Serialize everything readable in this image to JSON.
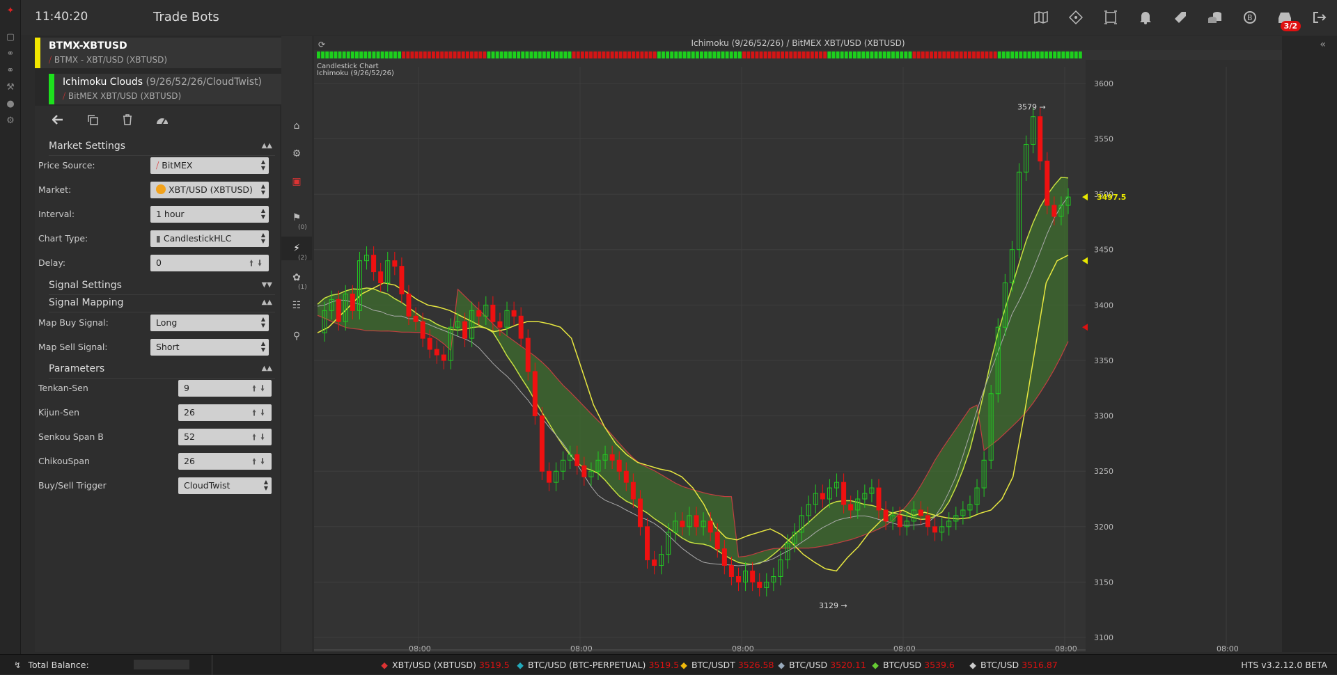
{
  "app": {
    "clock": "11:40:20",
    "title": "Trade Bots"
  },
  "left_rail_icons": [
    "logo-icon",
    "monitor-icon",
    "bot-icon",
    "bot2-icon",
    "tools-icon",
    "user-icon",
    "cogs-icon"
  ],
  "top_icons": [
    "map-icon",
    "ticket-icon",
    "frame-icon",
    "bell-icon",
    "tag-icon",
    "coins-icon",
    "bitcoin-icon",
    "inbox-icon",
    "logout-icon"
  ],
  "inbox_badge": "3/2",
  "crumbs": [
    {
      "title": "BTMX-XBTUSD",
      "subtitle": "BTMX - XBT/USD (XBTUSD)",
      "color": "#f2e600"
    },
    {
      "title": "Ichimoku Clouds",
      "params": "(9/26/52/26/CloudTwist)",
      "subtitle": "BitMEX XBT/USD (XBTUSD)",
      "color": "#1de01d"
    }
  ],
  "sections": {
    "market": "Market Settings",
    "signal": "Signal Settings",
    "mapping": "Signal Mapping",
    "params": "Parameters"
  },
  "market": {
    "price_source": {
      "label": "Price Source:",
      "value": "BitMEX"
    },
    "market": {
      "label": "Market:",
      "value": "XBT/USD (XBTUSD)"
    },
    "interval": {
      "label": "Interval:",
      "value": "1 hour"
    },
    "chart_type": {
      "label": "Chart Type:",
      "value": "CandlestickHLC"
    },
    "delay": {
      "label": "Delay:",
      "value": "0"
    }
  },
  "mapping": {
    "buy": {
      "label": "Map Buy Signal:",
      "value": "Long"
    },
    "sell": {
      "label": "Map Sell Signal:",
      "value": "Short"
    }
  },
  "params": {
    "tenkan": {
      "label": "Tenkan-Sen",
      "value": "9"
    },
    "kijun": {
      "label": "Kijun-Sen",
      "value": "26"
    },
    "senkou": {
      "label": "Senkou Span B",
      "value": "52"
    },
    "chikou": {
      "label": "ChikouSpan",
      "value": "26"
    },
    "trigger": {
      "label": "Buy/Sell Trigger",
      "value": "CloudTwist"
    }
  },
  "vtabs": [
    {
      "icon": "home-icon",
      "count": ""
    },
    {
      "icon": "cogs-icon",
      "count": ""
    },
    {
      "icon": "money-icon",
      "count": ""
    },
    {
      "icon": "flags-icon",
      "count": "(0)"
    },
    {
      "icon": "bolt-icon",
      "count": "(2)"
    },
    {
      "icon": "leaf-icon",
      "count": "(1)"
    },
    {
      "icon": "sitemap-icon",
      "count": ""
    },
    {
      "icon": "unlock-icon",
      "count": ""
    }
  ],
  "chart": {
    "title": "Ichimoku (9/26/52/26) / BitMEX XBT/USD (XBTUSD)",
    "sublabel1": "Candlestick Chart",
    "sublabel2": "Ichimoku (9/26/52/26)",
    "high_label": "3579",
    "low_label": "3129",
    "last_label": "3497.5"
  },
  "chart_data": {
    "type": "candlestick",
    "y_ticks": [
      "3600",
      "3550",
      "3500",
      "3450",
      "3400",
      "3350",
      "3300",
      "3250",
      "3200",
      "3150",
      "3100"
    ],
    "x_ticks": [
      "08:00",
      "08:00",
      "08:00",
      "08:00",
      "08:00",
      "08:00"
    ],
    "ylim": [
      3090,
      3615
    ],
    "last_price": 3497.5,
    "high": 3579,
    "low": 3129,
    "close_path": [
      3375,
      3395,
      3405,
      3385,
      3410,
      3395,
      3440,
      3445,
      3430,
      3420,
      3440,
      3435,
      3410,
      3390,
      3385,
      3370,
      3360,
      3355,
      3350,
      3380,
      3385,
      3370,
      3395,
      3390,
      3400,
      3385,
      3380,
      3395,
      3390,
      3370,
      3340,
      3300,
      3250,
      3240,
      3250,
      3260,
      3265,
      3255,
      3245,
      3250,
      3260,
      3265,
      3260,
      3250,
      3240,
      3225,
      3200,
      3170,
      3165,
      3175,
      3195,
      3205,
      3200,
      3210,
      3200,
      3205,
      3195,
      3180,
      3165,
      3155,
      3150,
      3160,
      3150,
      3145,
      3150,
      3155,
      3170,
      3185,
      3195,
      3210,
      3220,
      3230,
      3225,
      3235,
      3240,
      3220,
      3215,
      3225,
      3230,
      3235,
      3215,
      3205,
      3210,
      3200,
      3205,
      3215,
      3210,
      3200,
      3195,
      3200,
      3205,
      3210,
      3215,
      3220,
      3235,
      3260,
      3320,
      3380,
      3420,
      3450,
      3520,
      3545,
      3570,
      3530,
      3490,
      3480,
      3490,
      3497.5
    ],
    "tenkan_path": [
      3375,
      3380,
      3390,
      3400,
      3410,
      3415,
      3420,
      3418,
      3412,
      3405,
      3400,
      3398,
      3395,
      3390,
      3385,
      3380,
      3376,
      3378,
      3382,
      3385,
      3385,
      3383,
      3380,
      3370,
      3340,
      3310,
      3290,
      3275,
      3265,
      3258,
      3255,
      3252,
      3250,
      3245,
      3235,
      3220,
      3200,
      3190,
      3188,
      3192,
      3195,
      3198,
      3193,
      3185,
      3175,
      3168,
      3162,
      3160,
      3172,
      3182,
      3195,
      3205,
      3212,
      3215,
      3210,
      3213,
      3210,
      3208,
      3207,
      3208,
      3212,
      3215,
      3225,
      3245,
      3300,
      3360,
      3420,
      3440,
      3445
    ],
    "signal_strip": [
      "green",
      "red",
      "green",
      "red",
      "green",
      "red",
      "green",
      "red",
      "green"
    ],
    "price_axis_markers": [
      {
        "value": 3440,
        "color": "#e8e800"
      },
      {
        "value": 3380,
        "color": "#d11"
      }
    ]
  },
  "footer": {
    "balance_label": "Total Balance:",
    "tickers": [
      {
        "icon": "bitmex-icon",
        "pair": "XBT/USD (XBTUSD)",
        "price": "3519.5"
      },
      {
        "icon": "deribit-icon",
        "pair": "BTC/USD (BTC-PERPETUAL)",
        "price": "3519.5"
      },
      {
        "icon": "binance-icon",
        "pair": "BTC/USDT",
        "price": "3526.58"
      },
      {
        "icon": "bitfinex-icon",
        "pair": "BTC/USD",
        "price": "3520.11"
      },
      {
        "icon": "leaf-icon",
        "pair": "BTC/USD",
        "price": "3539.6"
      },
      {
        "icon": "exchange-icon",
        "pair": "BTC/USD",
        "price": "3516.87"
      }
    ],
    "version": "HTS v3.2.12.0 BETA"
  }
}
